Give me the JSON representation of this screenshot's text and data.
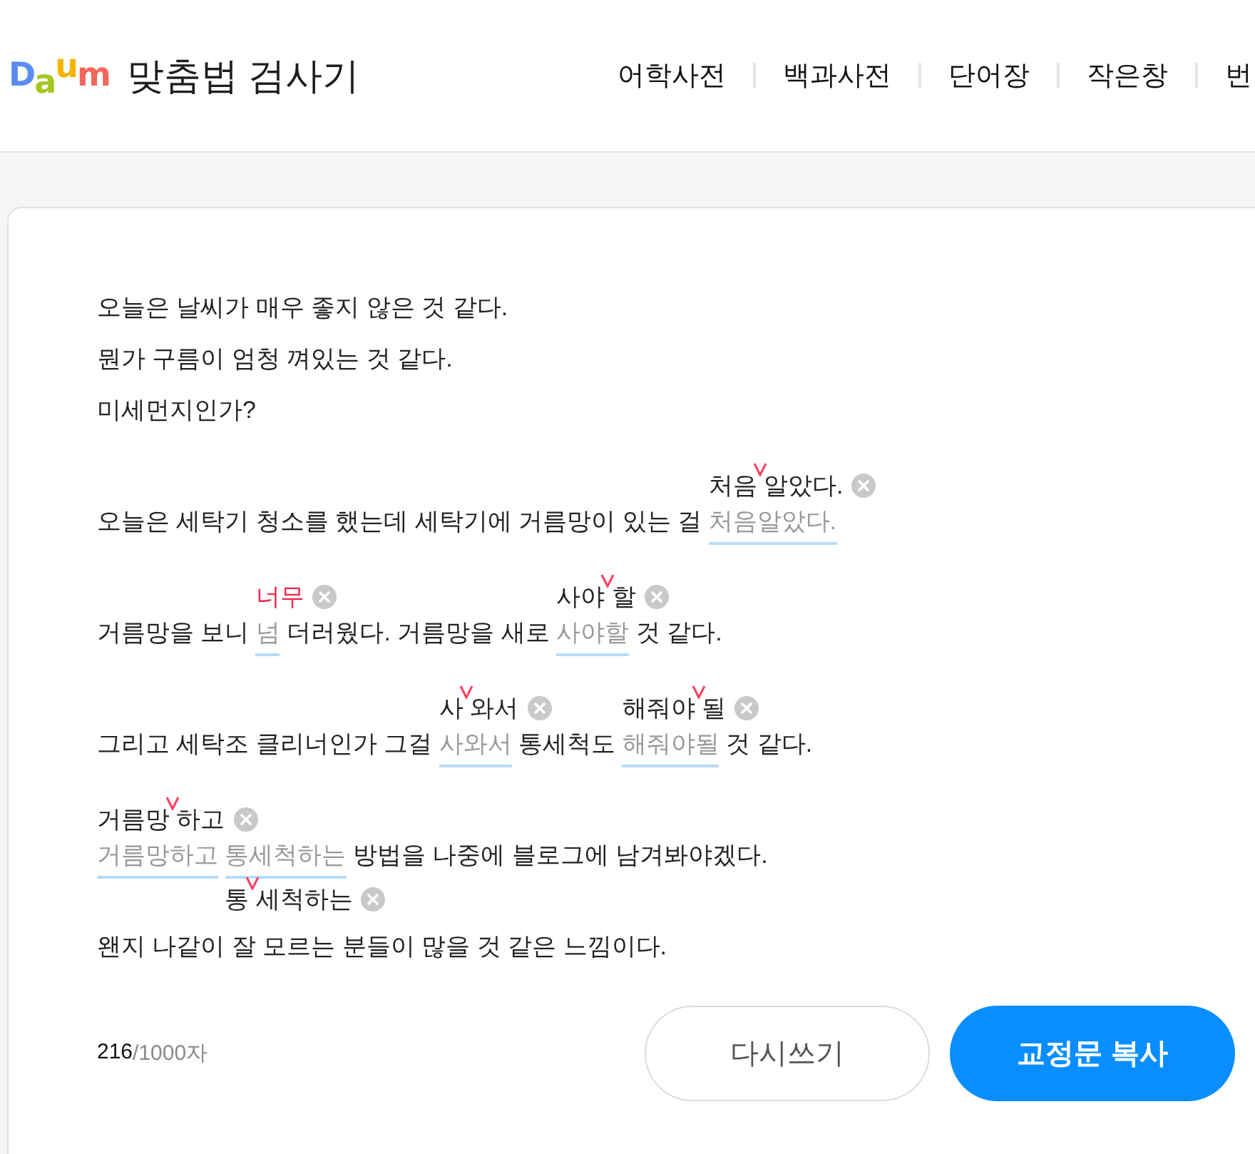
{
  "header": {
    "logo": "Daum",
    "title": "맞춤법 검사기",
    "nav": [
      "어학사전",
      "백과사전",
      "단어장",
      "작은창",
      "번"
    ]
  },
  "editor": {
    "paragraphs": [
      {
        "lines": [
          {
            "segments": [
              {
                "kind": "text",
                "text": "오늘은 날씨가 매우 좋지 않은 것 같다."
              }
            ]
          },
          {
            "segments": [
              {
                "kind": "text",
                "text": "뭔가 구름이 엄청 껴있는 것 같다."
              }
            ]
          },
          {
            "segments": [
              {
                "kind": "text",
                "text": "미세먼지인가?"
              }
            ]
          }
        ]
      },
      {
        "lines": [
          {
            "segments": [
              {
                "kind": "text",
                "text": "오늘은 세탁기 청소를 했는데 세탁기에 거름망이 있는 걸"
              },
              {
                "kind": "spacing",
                "text": "처음알았다.",
                "suggestion": "처음 알았다.",
                "below": false
              }
            ]
          }
        ]
      },
      {
        "lines": [
          {
            "segments": [
              {
                "kind": "text",
                "text": "거름망을 보니"
              },
              {
                "kind": "replace",
                "text": "넘",
                "suggestion": "너무",
                "below": false
              },
              {
                "kind": "text",
                "text": "더러웠다. 거름망을 새로"
              },
              {
                "kind": "spacing",
                "text": "사야할",
                "suggestion": "사야 할",
                "below": false
              },
              {
                "kind": "text",
                "text": "것 같다."
              }
            ]
          }
        ]
      },
      {
        "lines": [
          {
            "segments": [
              {
                "kind": "text",
                "text": "그리고 세탁조 클리너인가 그걸"
              },
              {
                "kind": "spacing",
                "text": "사와서",
                "suggestion": "사 와서",
                "below": false
              },
              {
                "kind": "text",
                "text": "통세척도"
              },
              {
                "kind": "spacing",
                "text": "해줘야될",
                "suggestion": "해줘야 될",
                "below": false
              },
              {
                "kind": "text",
                "text": "것 같다."
              }
            ]
          }
        ]
      },
      {
        "lines": [
          {
            "segments": [
              {
                "kind": "spacing",
                "text": "거름망하고",
                "suggestion": "거름망 하고",
                "below": false
              },
              {
                "kind": "spacing",
                "text": "통세척하는",
                "suggestion": "통 세척하는",
                "below": true
              },
              {
                "kind": "text",
                "text": "방법을 나중에 블로그에 남겨봐야겠다."
              }
            ]
          },
          {
            "segments": [
              {
                "kind": "text",
                "text": "왠지 나같이 잘 모르는 분들이 많을 것 같은 느낌이다."
              }
            ]
          }
        ]
      }
    ]
  },
  "footer": {
    "counter": {
      "count": "216",
      "limit": "/1000자"
    },
    "buttons": [
      {
        "label": "다시쓰기",
        "kind": "outline"
      },
      {
        "label": "교정문 복사",
        "kind": "primary"
      }
    ]
  }
}
